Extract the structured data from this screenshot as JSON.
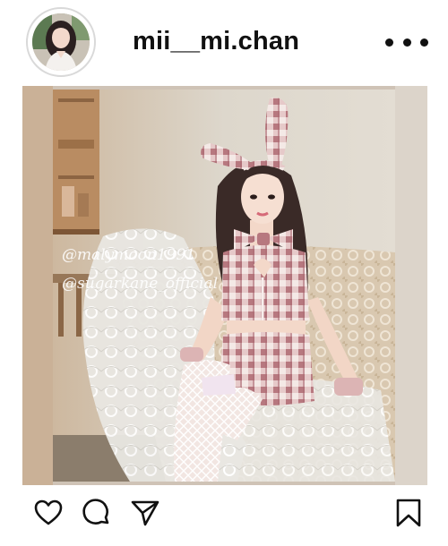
{
  "post": {
    "username": "mii__mi.chan",
    "image_watermarks": [
      "@malymoon1991",
      "@sugarkane_official"
    ]
  },
  "icons": {
    "avatar": "profile-avatar",
    "more": "more-horizontal-icon",
    "like": "heart-icon",
    "comment": "comment-icon",
    "share": "send-icon",
    "save": "bookmark-icon"
  },
  "colors": {
    "text": "#111111",
    "avatar_ring": "#d9d9d9",
    "outfit_pink": "#c98f95"
  }
}
